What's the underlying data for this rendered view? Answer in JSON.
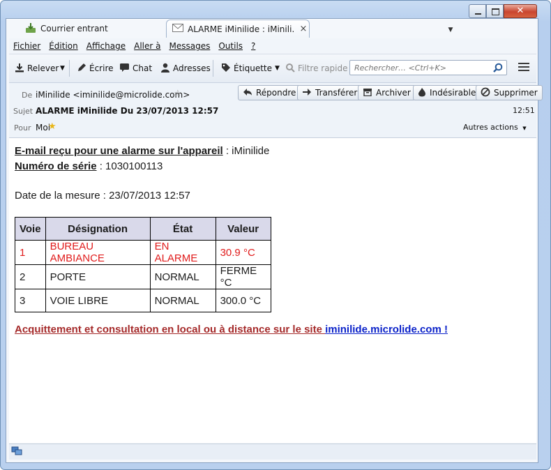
{
  "tabs": [
    {
      "label": "Courrier entrant",
      "icon": "inbox-icon"
    },
    {
      "label": "ALARME iMinilide : iMinili…",
      "icon": "envelope-icon",
      "close": "×"
    }
  ],
  "menubar": [
    "Fichier",
    "Édition",
    "Affichage",
    "Aller à",
    "Messages",
    "Outils",
    "?"
  ],
  "toolbar": {
    "relever": "Relever",
    "ecrire": "Écrire",
    "chat": "Chat",
    "adresses": "Adresses",
    "etiquette": "Étiquette",
    "filtre": "Filtre rapide",
    "search_placeholder": "Rechercher… <Ctrl+K>"
  },
  "header": {
    "from_label": "De",
    "from_value": "iMinilide <iminilide@microlide.com>",
    "subject_label": "Sujet",
    "subject_value": "ALARME iMinilide Du 23/07/2013 12:57",
    "time": "12:51",
    "to_label": "Pour",
    "to_value": "Moi",
    "other_actions": "Autres actions",
    "buttons": {
      "repondre": "Répondre",
      "transferer": "Transférer",
      "archiver": "Archiver",
      "indesirable": "Indésirable",
      "supprimer": "Supprimer"
    }
  },
  "body": {
    "line1_label": "E-mail reçu pour une alarme sur l'appareil",
    "line1_value": " : iMinilide",
    "line2_label": "Numéro de série",
    "line2_value": " : 1030100113",
    "date_line": "Date de la mesure : 23/07/2013 12:57",
    "table": {
      "headers": [
        "Voie",
        "Désignation",
        "État",
        "Valeur"
      ],
      "rows": [
        [
          "1",
          "BUREAU AMBIANCE",
          "EN ALARME",
          "30.9 °C"
        ],
        [
          "2",
          "PORTE",
          "NORMAL",
          "FERME °C"
        ],
        [
          "3",
          "VOIE LIBRE",
          "NORMAL",
          "300.0 °C"
        ]
      ]
    },
    "footer_text": "Acquittement et consultation en local ou à distance sur le site ",
    "footer_link": "iminilide.microlide.com !"
  },
  "colors": {
    "alarm": "#e01b1b",
    "footer": "#a52a2a",
    "link": "#0b22c9",
    "table_header": "#d9d9ea"
  }
}
